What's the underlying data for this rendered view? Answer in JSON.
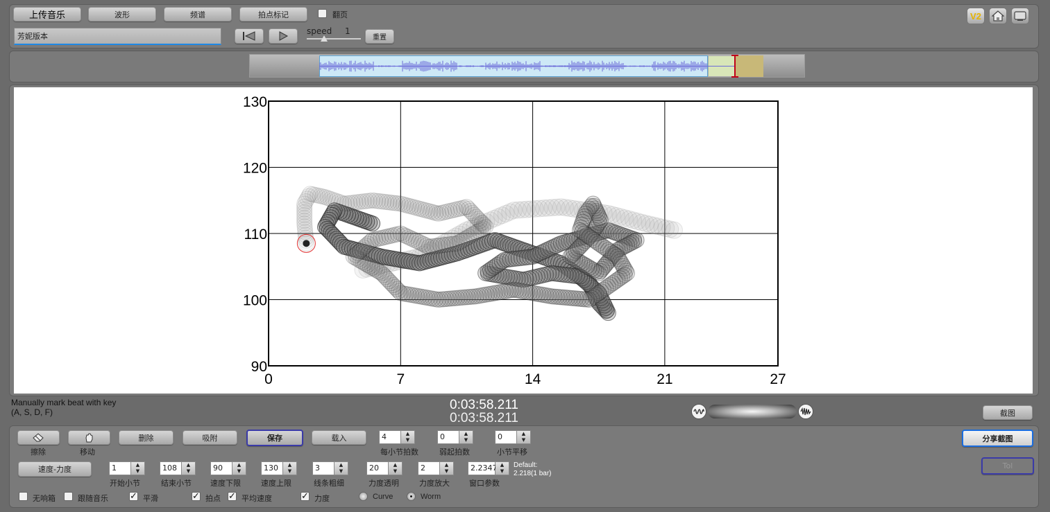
{
  "toolbar": {
    "upload_label": "上传音乐",
    "waveform_label": "波形",
    "spectrum_label": "频谱",
    "beat_mark_label": "拍点标记",
    "page_turn_label": "翻页",
    "track_name": "芳妮版本",
    "speed_label": "speed",
    "speed_value": "1",
    "reset_label": "重置",
    "v2_label": "V2"
  },
  "chart_data": {
    "type": "scatter",
    "style": "worm",
    "xlim": [
      0,
      27
    ],
    "ylim": [
      90,
      130
    ],
    "xticks": [
      "0",
      "7",
      "14",
      "21",
      "27"
    ],
    "yticks": [
      "90",
      "100",
      "110",
      "120",
      "130"
    ],
    "grid": true,
    "trail": [
      [
        2.0,
        108.5
      ],
      [
        1.9,
        111.5
      ],
      [
        1.9,
        114.5
      ],
      [
        2.2,
        116.0
      ],
      [
        3.0,
        115.5
      ],
      [
        4.0,
        114.5
      ],
      [
        5.5,
        115.0
      ],
      [
        7.0,
        114.5
      ],
      [
        9.0,
        113.0
      ],
      [
        10.5,
        114.0
      ],
      [
        11.5,
        111.0
      ],
      [
        10.0,
        108.5
      ],
      [
        8.5,
        108.0
      ],
      [
        7.0,
        110.0
      ],
      [
        5.5,
        109.0
      ],
      [
        4.5,
        106.5
      ],
      [
        6.0,
        104.0
      ],
      [
        7.0,
        101.0
      ],
      [
        9.0,
        100.0
      ],
      [
        11.0,
        100.5
      ],
      [
        13.0,
        101.5
      ],
      [
        15.0,
        100.5
      ],
      [
        17.0,
        100.0
      ],
      [
        18.0,
        102.0
      ],
      [
        19.0,
        104.0
      ],
      [
        18.5,
        106.5
      ],
      [
        17.5,
        108.5
      ],
      [
        16.5,
        110.5
      ],
      [
        16.8,
        113.0
      ],
      [
        17.2,
        114.5
      ],
      [
        17.6,
        112.0
      ],
      [
        17.0,
        109.5
      ],
      [
        16.0,
        106.5
      ],
      [
        17.5,
        104.0
      ],
      [
        18.5,
        107.5
      ],
      [
        19.5,
        109.0
      ],
      [
        18.0,
        110.5
      ],
      [
        15.5,
        108.5
      ],
      [
        14.0,
        106.5
      ],
      [
        12.5,
        106.0
      ],
      [
        11.5,
        104.0
      ],
      [
        13.5,
        103.0
      ],
      [
        15.0,
        104.0
      ],
      [
        16.5,
        103.5
      ],
      [
        17.5,
        101.0
      ],
      [
        18.0,
        98.0
      ],
      [
        17.5,
        99.5
      ],
      [
        17.0,
        102.5
      ],
      [
        15.5,
        105.5
      ],
      [
        13.5,
        107.5
      ],
      [
        12.0,
        109.0
      ],
      [
        10.0,
        107.0
      ],
      [
        8.0,
        105.5
      ],
      [
        6.0,
        106.5
      ],
      [
        4.0,
        108.0
      ],
      [
        3.0,
        111.0
      ],
      [
        3.5,
        113.5
      ],
      [
        4.5,
        112.5
      ],
      [
        5.5,
        111.5
      ]
    ],
    "faint_trail": [
      [
        5.0,
        104.5
      ],
      [
        8.0,
        106.5
      ],
      [
        10.5,
        110.5
      ],
      [
        13.0,
        113.5
      ],
      [
        15.5,
        114.0
      ],
      [
        18.0,
        113.0
      ],
      [
        20.0,
        111.5
      ],
      [
        21.5,
        110.5
      ]
    ],
    "current_point": [
      2.0,
      108.5
    ]
  },
  "status": {
    "instructions": "Manually mark beat with key\n(A, S, D, F)",
    "time_current": "0:03:58.211",
    "time_total": "0:03:58.211",
    "screenshot_label": "截图"
  },
  "controls": {
    "erase_label": "擦除",
    "move_label": "移动",
    "delete_label": "删除",
    "snap_label": "吸附",
    "save_label": "保存",
    "load_label": "载入",
    "beats_per_bar": {
      "value": "4",
      "label": "每小节拍数"
    },
    "weak_beats": {
      "value": "0",
      "label": "弱起拍数"
    },
    "bar_shift": {
      "value": "0",
      "label": "小节平移"
    },
    "share_label": "分享截图",
    "tol_label": "Tol",
    "mode_label": "速度-力度",
    "start_bar": {
      "value": "1",
      "label": "开始小节"
    },
    "end_bar": {
      "value": "108",
      "label": "结束小节"
    },
    "tempo_min": {
      "value": "90",
      "label": "速度下限"
    },
    "tempo_max": {
      "value": "130",
      "label": "速度上限"
    },
    "line_width": {
      "value": "3",
      "label": "线条粗细"
    },
    "dyn_opacity": {
      "value": "20",
      "label": "力度透明"
    },
    "dyn_scale": {
      "value": "2",
      "label": "力度放大"
    },
    "window_param": {
      "value": "2.2347",
      "label": "窗口参数"
    },
    "default_text": "Default:\n2.218(1 bar)",
    "no_drag_label": "无响箱",
    "follow_music_label": "跟随音乐",
    "smooth_label": "平滑",
    "beats_label": "拍点",
    "avg_tempo_label": "平均速度",
    "dynamics_label": "力度",
    "curve_label": "Curve",
    "worm_label": "Worm"
  }
}
